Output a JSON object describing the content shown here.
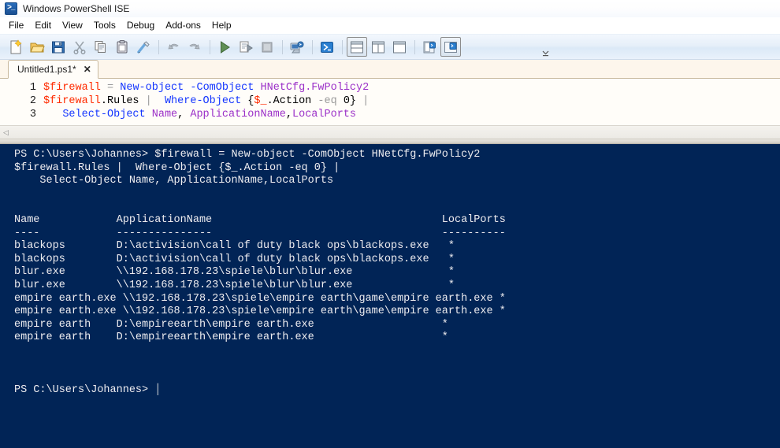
{
  "window": {
    "title": "Windows PowerShell ISE",
    "icon": "powershell-icon"
  },
  "menubar": {
    "items": [
      {
        "label": "File",
        "name": "menu-file"
      },
      {
        "label": "Edit",
        "name": "menu-edit"
      },
      {
        "label": "View",
        "name": "menu-view"
      },
      {
        "label": "Tools",
        "name": "menu-tools"
      },
      {
        "label": "Debug",
        "name": "menu-debug"
      },
      {
        "label": "Add-ons",
        "name": "menu-addons"
      },
      {
        "label": "Help",
        "name": "menu-help"
      }
    ]
  },
  "toolbar": {
    "overflow_label": "Toolbar options",
    "buttons": [
      {
        "icon": "new-script-icon",
        "tooltip": "New"
      },
      {
        "icon": "open-folder-icon",
        "tooltip": "Open"
      },
      {
        "icon": "save-floppy-icon",
        "tooltip": "Save"
      },
      {
        "icon": "cut-scissors-icon",
        "tooltip": "Cut"
      },
      {
        "icon": "copy-pages-icon",
        "tooltip": "Copy"
      },
      {
        "icon": "paste-clipboard-icon",
        "tooltip": "Paste"
      },
      {
        "icon": "clear-console-icon",
        "tooltip": "Clear Console Pane"
      },
      {
        "separator": true
      },
      {
        "icon": "undo-arrow-icon",
        "tooltip": "Undo"
      },
      {
        "icon": "redo-arrow-icon",
        "tooltip": "Redo"
      },
      {
        "separator": true
      },
      {
        "icon": "run-script-icon",
        "tooltip": "Run Script"
      },
      {
        "icon": "run-selection-icon",
        "tooltip": "Run Selection"
      },
      {
        "icon": "stop-script-icon",
        "tooltip": "Stop Operation"
      },
      {
        "separator": true
      },
      {
        "icon": "new-remote-tab-icon",
        "tooltip": "New Remote PowerShell Tab"
      },
      {
        "separator": true
      },
      {
        "icon": "start-powershell-icon",
        "tooltip": "Start PowerShell.exe"
      },
      {
        "separator": true
      },
      {
        "icon": "layout-stacked-icon",
        "tooltip": "Show Script Pane Top",
        "pressed": true
      },
      {
        "icon": "layout-side-icon",
        "tooltip": "Show Script Pane Right"
      },
      {
        "icon": "layout-maximized-icon",
        "tooltip": "Show Script Pane Maximized"
      },
      {
        "separator": true
      },
      {
        "icon": "show-script-pane-icon",
        "tooltip": "Show Script Pane"
      },
      {
        "icon": "show-console-pane-icon",
        "tooltip": "Show Command Pane",
        "pressed": true
      }
    ]
  },
  "tabs": [
    {
      "label": "Untitled1.ps1*",
      "close_label": "✕",
      "active": true
    }
  ],
  "editor": {
    "lines": [
      {
        "number": "1",
        "tokens": [
          {
            "t": "$firewall",
            "c": "tk-var"
          },
          {
            "t": " ",
            "c": "tk-plain"
          },
          {
            "t": "=",
            "c": "tk-op"
          },
          {
            "t": " ",
            "c": "tk-plain"
          },
          {
            "t": "New-object",
            "c": "tk-cmd"
          },
          {
            "t": " ",
            "c": "tk-plain"
          },
          {
            "t": "-ComObject",
            "c": "tk-param"
          },
          {
            "t": " ",
            "c": "tk-plain"
          },
          {
            "t": "HNetCfg.FwPolicy2",
            "c": "tk-type"
          }
        ]
      },
      {
        "number": "2",
        "tokens": [
          {
            "t": "$firewall",
            "c": "tk-var"
          },
          {
            "t": ".Rules",
            "c": "tk-plain"
          },
          {
            "t": " ",
            "c": "tk-plain"
          },
          {
            "t": "|",
            "c": "tk-op"
          },
          {
            "t": "  ",
            "c": "tk-plain"
          },
          {
            "t": "Where-Object",
            "c": "tk-cmd"
          },
          {
            "t": " {",
            "c": "tk-plain"
          },
          {
            "t": "$_",
            "c": "tk-var"
          },
          {
            "t": ".Action",
            "c": "tk-plain"
          },
          {
            "t": " ",
            "c": "tk-plain"
          },
          {
            "t": "-eq",
            "c": "tk-op"
          },
          {
            "t": " 0} ",
            "c": "tk-plain"
          },
          {
            "t": "|",
            "c": "tk-op"
          }
        ]
      },
      {
        "number": "3",
        "tokens": [
          {
            "t": "   ",
            "c": "tk-plain"
          },
          {
            "t": "Select-Object",
            "c": "tk-cmd"
          },
          {
            "t": " ",
            "c": "tk-plain"
          },
          {
            "t": "Name",
            "c": "tk-prop"
          },
          {
            "t": ", ",
            "c": "tk-plain"
          },
          {
            "t": "ApplicationName",
            "c": "tk-prop"
          },
          {
            "t": ",",
            "c": "tk-plain"
          },
          {
            "t": "LocalPorts",
            "c": "tk-prop"
          }
        ]
      }
    ]
  },
  "console": {
    "prompt": "PS C:\\Users\\Johannes>",
    "lines": [
      "PS C:\\Users\\Johannes> $firewall = New-object -ComObject HNetCfg.FwPolicy2",
      "$firewall.Rules |  Where-Object {$_.Action -eq 0} |",
      "    Select-Object Name, ApplicationName,LocalPorts",
      "",
      "",
      "Name            ApplicationName                                    LocalPorts",
      "----            ---------------                                    ----------",
      "blackops        D:\\activision\\call of duty black ops\\blackops.exe   *",
      "blackops        D:\\activision\\call of duty black ops\\blackops.exe   *",
      "blur.exe        \\\\192.168.178.23\\spiele\\blur\\blur.exe               *",
      "blur.exe        \\\\192.168.178.23\\spiele\\blur\\blur.exe               *",
      "empire earth.exe \\\\192.168.178.23\\spiele\\empire earth\\game\\empire earth.exe *",
      "empire earth.exe \\\\192.168.178.23\\spiele\\empire earth\\game\\empire earth.exe *",
      "empire earth    D:\\empireearth\\empire earth.exe                    *",
      "empire earth    D:\\empireearth\\empire earth.exe                    *",
      "",
      "",
      "",
      "PS C:\\Users\\Johannes> "
    ],
    "table": {
      "headers": [
        "Name",
        "ApplicationName",
        "LocalPorts"
      ],
      "header_rules": [
        "----",
        "---------------",
        "----------"
      ],
      "rows": [
        {
          "Name": "blackops",
          "ApplicationName": "D:\\activision\\call of duty black ops\\blackops.exe",
          "LocalPorts": "*"
        },
        {
          "Name": "blackops",
          "ApplicationName": "D:\\activision\\call of duty black ops\\blackops.exe",
          "LocalPorts": "*"
        },
        {
          "Name": "blur.exe",
          "ApplicationName": "\\\\192.168.178.23\\spiele\\blur\\blur.exe",
          "LocalPorts": "*"
        },
        {
          "Name": "blur.exe",
          "ApplicationName": "\\\\192.168.178.23\\spiele\\blur\\blur.exe",
          "LocalPorts": "*"
        },
        {
          "Name": "empire earth.exe",
          "ApplicationName": "\\\\192.168.178.23\\spiele\\empire earth\\game\\empire earth.exe",
          "LocalPorts": "*"
        },
        {
          "Name": "empire earth.exe",
          "ApplicationName": "\\\\192.168.178.23\\spiele\\empire earth\\game\\empire earth.exe",
          "LocalPorts": "*"
        },
        {
          "Name": "empire earth",
          "ApplicationName": "D:\\empireearth\\empire earth.exe",
          "LocalPorts": "*"
        },
        {
          "Name": "empire earth",
          "ApplicationName": "D:\\empireearth\\empire earth.exe",
          "LocalPorts": "*"
        }
      ]
    }
  },
  "colors": {
    "console_background": "#012456",
    "console_foreground": "#eeedf0",
    "editor_background": "#fffdf9",
    "variable": "#ff2b00",
    "cmdlet": "#1335ff",
    "type": "#9b30c8",
    "operator": "#9a9a9a"
  }
}
